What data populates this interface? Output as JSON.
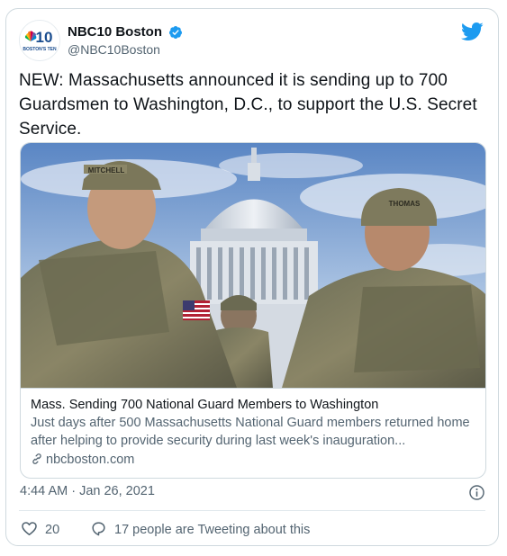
{
  "account": {
    "display_name": "NBC10 Boston",
    "handle": "@NBC10Boston",
    "logo_text_big": "10",
    "logo_text_small": "BOSTON'S TEN"
  },
  "tweet": {
    "text": "NEW: Massachusetts announced it is sending up to 700 Guardsmen to Washington, D.C., to support the U.S. Secret Service."
  },
  "link_card": {
    "title": "Mass. Sending 700 National Guard Members to Washington",
    "description": "Just days after 500 Massachusetts National Guard members returned home after helping to provide security during last week's inauguration...",
    "domain": "nbcboston.com",
    "photo_patches": [
      "MITCHELL",
      "THOMAS"
    ]
  },
  "meta": {
    "timestamp": "4:44 AM · Jan 26, 2021"
  },
  "actions": {
    "like_count": "20",
    "conversation_label": "17 people are Tweeting about this"
  },
  "colors": {
    "twitter_blue": "#1d9bf0",
    "secondary_text": "#536471",
    "border": "#cfd9de"
  }
}
